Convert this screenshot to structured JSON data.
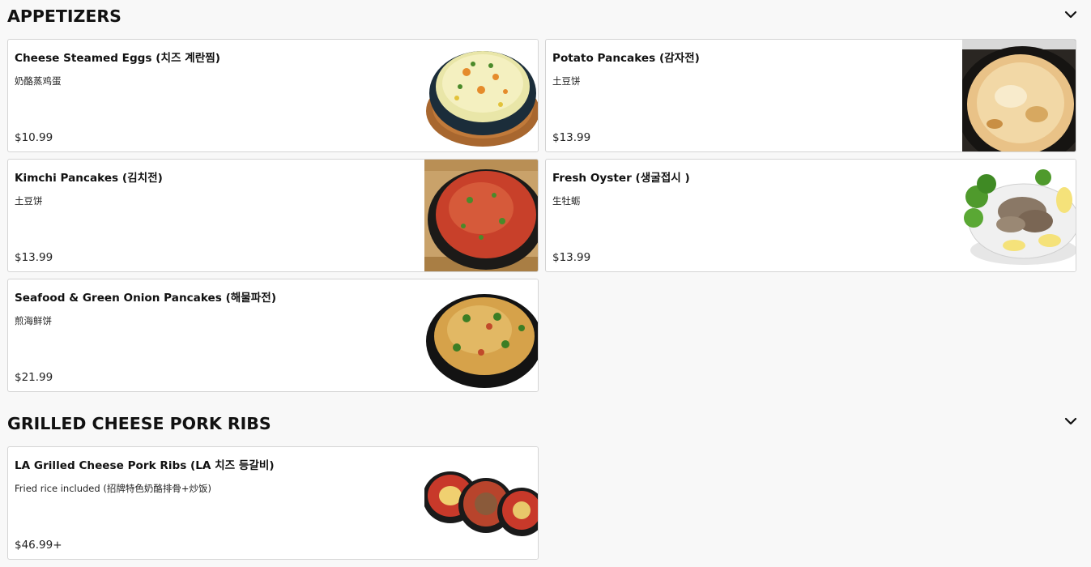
{
  "sections": [
    {
      "title": "APPETIZERS",
      "items": [
        {
          "name": "Cheese Steamed Eggs (치즈 계란찜)",
          "description": "奶酪蒸鸡蛋",
          "price": "$10.99",
          "image": "steamed-egg-photo"
        },
        {
          "name": "Potato Pancakes (감자전)",
          "description": "土豆饼",
          "price": "$13.99",
          "image": "potato-pancake-photo"
        },
        {
          "name": "Kimchi Pancakes (김치전)",
          "description": "土豆饼",
          "price": "$13.99",
          "image": "kimchi-pancake-photo"
        },
        {
          "name": "Fresh Oyster (생굴접시 )",
          "description": "生牡蛎",
          "price": "$13.99",
          "image": "oyster-plate-photo"
        },
        {
          "name": "Seafood & Green Onion Pancakes (해물파전)",
          "description": "煎海鲜饼",
          "price": "$21.99",
          "image": "seafood-pancake-photo"
        }
      ]
    },
    {
      "title": "GRILLED CHEESE PORK RIBS",
      "items": [
        {
          "name": "LA Grilled Cheese Pork Ribs (LA 치즈 등갈비)",
          "description": "Fried rice included (招牌特色奶酪排骨+炒饭)",
          "price": "$46.99+",
          "image": "pork-ribs-photo"
        }
      ]
    }
  ],
  "icons": {
    "collapse": "chevron-down-icon"
  }
}
